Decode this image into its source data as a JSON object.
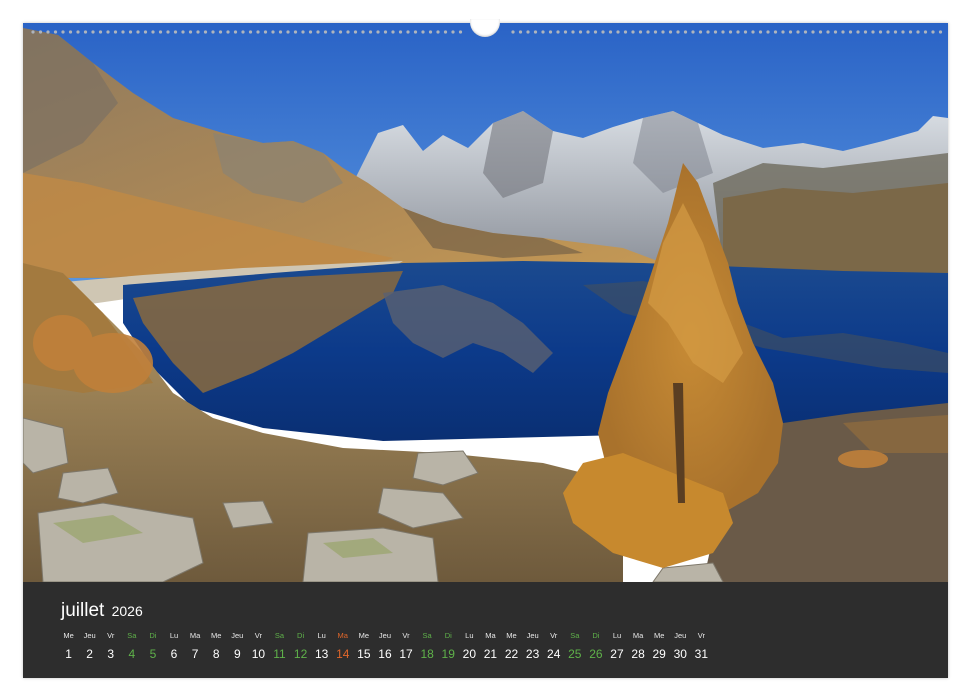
{
  "calendar": {
    "month": "juillet",
    "year": "2026",
    "days": [
      {
        "name": "Me",
        "num": "1",
        "kind": "wd"
      },
      {
        "name": "Jeu",
        "num": "2",
        "kind": "wd"
      },
      {
        "name": "Vr",
        "num": "3",
        "kind": "wd"
      },
      {
        "name": "Sa",
        "num": "4",
        "kind": "we"
      },
      {
        "name": "Di",
        "num": "5",
        "kind": "we"
      },
      {
        "name": "Lu",
        "num": "6",
        "kind": "wd"
      },
      {
        "name": "Ma",
        "num": "7",
        "kind": "wd"
      },
      {
        "name": "Me",
        "num": "8",
        "kind": "wd"
      },
      {
        "name": "Jeu",
        "num": "9",
        "kind": "wd"
      },
      {
        "name": "Vr",
        "num": "10",
        "kind": "wd"
      },
      {
        "name": "Sa",
        "num": "11",
        "kind": "we"
      },
      {
        "name": "Di",
        "num": "12",
        "kind": "we"
      },
      {
        "name": "Lu",
        "num": "13",
        "kind": "wd"
      },
      {
        "name": "Ma",
        "num": "14",
        "kind": "hol"
      },
      {
        "name": "Me",
        "num": "15",
        "kind": "wd"
      },
      {
        "name": "Jeu",
        "num": "16",
        "kind": "wd"
      },
      {
        "name": "Vr",
        "num": "17",
        "kind": "wd"
      },
      {
        "name": "Sa",
        "num": "18",
        "kind": "we"
      },
      {
        "name": "Di",
        "num": "19",
        "kind": "we"
      },
      {
        "name": "Lu",
        "num": "20",
        "kind": "wd"
      },
      {
        "name": "Ma",
        "num": "21",
        "kind": "wd"
      },
      {
        "name": "Me",
        "num": "22",
        "kind": "wd"
      },
      {
        "name": "Jeu",
        "num": "23",
        "kind": "wd"
      },
      {
        "name": "Vr",
        "num": "24",
        "kind": "wd"
      },
      {
        "name": "Sa",
        "num": "25",
        "kind": "we"
      },
      {
        "name": "Di",
        "num": "26",
        "kind": "we"
      },
      {
        "name": "Lu",
        "num": "27",
        "kind": "wd"
      },
      {
        "name": "Ma",
        "num": "28",
        "kind": "wd"
      },
      {
        "name": "Me",
        "num": "29",
        "kind": "wd"
      },
      {
        "name": "Jeu",
        "num": "30",
        "kind": "wd"
      },
      {
        "name": "Vr",
        "num": "31",
        "kind": "wd"
      }
    ]
  },
  "colors": {
    "footer_bg": "#2d2d2d",
    "weekend": "#5fb24a",
    "holiday": "#e0662a",
    "sky": "#2f6fd0",
    "lake": "#0f3f8e",
    "larch": "#c98a2e"
  },
  "photo": {
    "subject": "alpine-lake-larch-autumn"
  }
}
